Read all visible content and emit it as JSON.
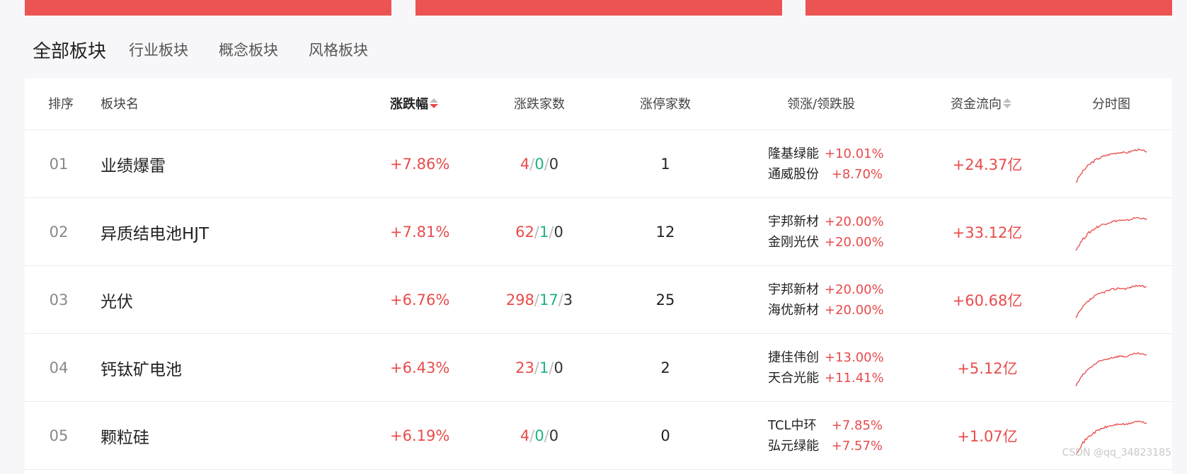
{
  "tabs": [
    {
      "label": "全部板块",
      "active": true
    },
    {
      "label": "行业板块",
      "active": false
    },
    {
      "label": "概念板块",
      "active": false
    },
    {
      "label": "风格板块",
      "active": false
    }
  ],
  "columns": {
    "rank": "排序",
    "name": "板块名",
    "change": "涨跌幅",
    "updown_count": "涨跌家数",
    "limit_count": "涨停家数",
    "leaders": "领涨/领跌股",
    "fund_flow": "资金流向",
    "intraday": "分时图"
  },
  "rows": [
    {
      "rank": "01",
      "name": "业绩爆雷",
      "change": "+7.86%",
      "up": "4",
      "flat": "0",
      "down": "0",
      "limit": "1",
      "leader1": "隆基绿能",
      "leader1_pct": "+10.01%",
      "leader2": "通威股份",
      "leader2_pct": "+8.70%",
      "flow": "+24.37亿"
    },
    {
      "rank": "02",
      "name": "异质结电池HJT",
      "change": "+7.81%",
      "up": "62",
      "flat": "1",
      "down": "0",
      "limit": "12",
      "leader1": "宇邦新材",
      "leader1_pct": "+20.00%",
      "leader2": "金刚光伏",
      "leader2_pct": "+20.00%",
      "flow": "+33.12亿"
    },
    {
      "rank": "03",
      "name": "光伏",
      "change": "+6.76%",
      "up": "298",
      "flat": "17",
      "down": "3",
      "limit": "25",
      "leader1": "宇邦新材",
      "leader1_pct": "+20.00%",
      "leader2": "海优新材",
      "leader2_pct": "+20.00%",
      "flow": "+60.68亿"
    },
    {
      "rank": "04",
      "name": "钙钛矿电池",
      "change": "+6.43%",
      "up": "23",
      "flat": "1",
      "down": "0",
      "limit": "2",
      "leader1": "捷佳伟创",
      "leader1_pct": "+13.00%",
      "leader2": "天合光能",
      "leader2_pct": "+11.41%",
      "flow": "+5.12亿"
    },
    {
      "rank": "05",
      "name": "颗粒硅",
      "change": "+6.19%",
      "up": "4",
      "flat": "0",
      "down": "0",
      "limit": "0",
      "leader1": "TCL中环",
      "leader1_pct": "+7.85%",
      "leader2": "弘元绿能",
      "leader2_pct": "+7.57%",
      "flow": "+1.07亿"
    }
  ],
  "sparkline_color": "#e94b4b",
  "up_color": "#e94b4b",
  "flat_color": "#1fb37e",
  "watermark": "CSDN @qq_34823185"
}
